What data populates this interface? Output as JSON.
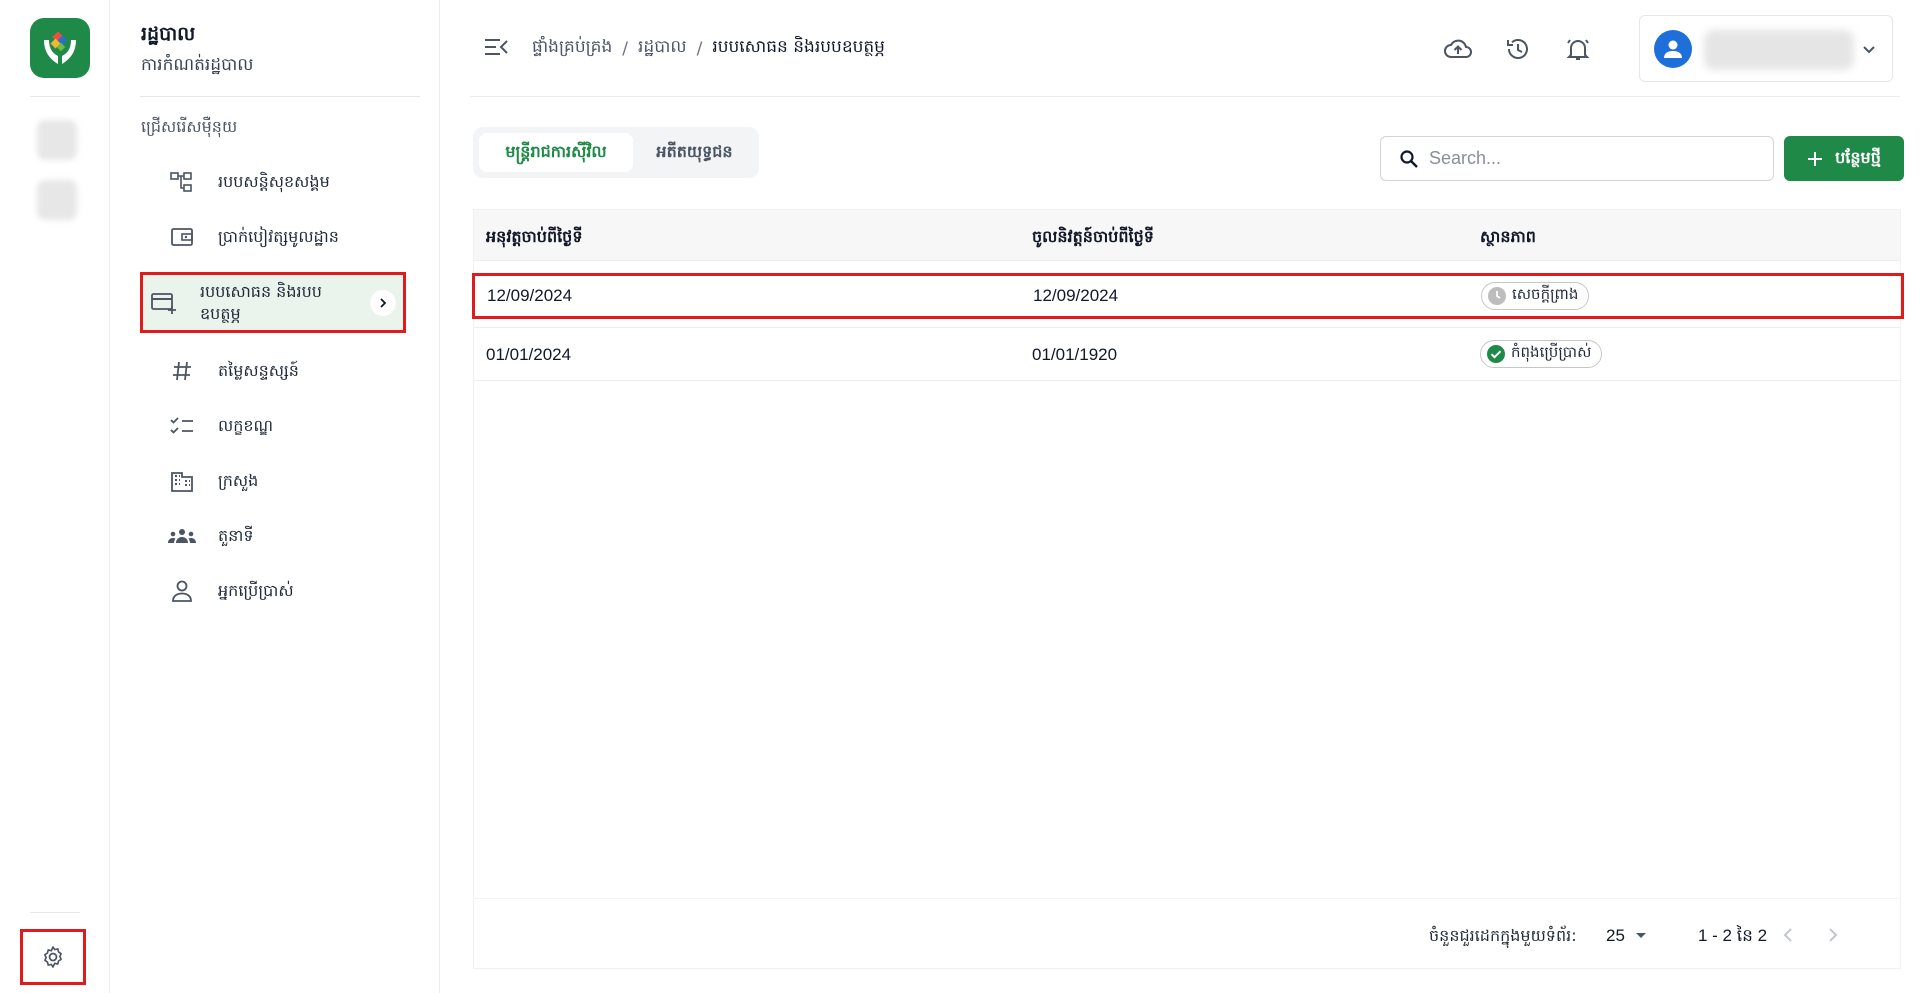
{
  "sidemenu": {
    "title": "រដ្ឋបាល",
    "subtitle": "ការកំណត់រដ្ឋបាល",
    "section_label": "ជ្រើសរើសម៉ឺនុយ",
    "items": [
      {
        "label": "របបសន្តិសុខសង្គម",
        "icon": "hierarchy-icon"
      },
      {
        "label": "ប្រាក់បៀវត្សមូលដ្ឋាន",
        "icon": "wallet-icon"
      },
      {
        "label": "របបសោធន និងរបបឧបត្ថម្ភ",
        "icon": "card-add-icon",
        "active": true
      },
      {
        "label": "តម្លៃសន្ទស្សន៍",
        "icon": "hash-icon"
      },
      {
        "label": "លក្ខខណ្ឌ",
        "icon": "checklist-icon"
      },
      {
        "label": "ក្រសួង",
        "icon": "building-icon"
      },
      {
        "label": "តួនាទី",
        "icon": "group-icon"
      },
      {
        "label": "អ្នកប្រើប្រាស់",
        "icon": "user-icon"
      }
    ]
  },
  "header": {
    "breadcrumb": [
      "ផ្ទាំងគ្រប់គ្រង",
      "រដ្ឋបាល",
      "របបសោធន និងរបបឧបត្ថម្ភ"
    ],
    "separator": "/"
  },
  "tabs": [
    {
      "label": "មន្ត្រីរាជការស៊ីវិល",
      "active": true
    },
    {
      "label": "អតីតយុទ្ធជន",
      "active": false
    }
  ],
  "search": {
    "placeholder": "Search..."
  },
  "add_button": {
    "label": "បន្ថែមថ្មី"
  },
  "table": {
    "columns": [
      "អនុវត្តចាប់ពីថ្ងៃទី",
      "ចូលនិវត្តន៍ចាប់ពីថ្ងៃទី",
      "ស្ថានភាព"
    ],
    "rows": [
      {
        "apply_from": "12/09/2024",
        "retire_from": "12/09/2024",
        "status": "សេចក្ដីព្រាង",
        "status_type": "draft"
      },
      {
        "apply_from": "01/01/2024",
        "retire_from": "01/01/1920",
        "status": "កំពុងប្រើប្រាស់",
        "status_type": "active"
      }
    ]
  },
  "pagination": {
    "rows_per_page_label": "ចំនួនជួរដេកក្នុងមួយទំព័រ:",
    "rows_per_page": "25",
    "range": "1 - 2 នៃ 2"
  },
  "colors": {
    "brand_green": "#1f8a47",
    "highlight_red": "#e01b1b",
    "avatar_blue": "#1e6fd9"
  }
}
